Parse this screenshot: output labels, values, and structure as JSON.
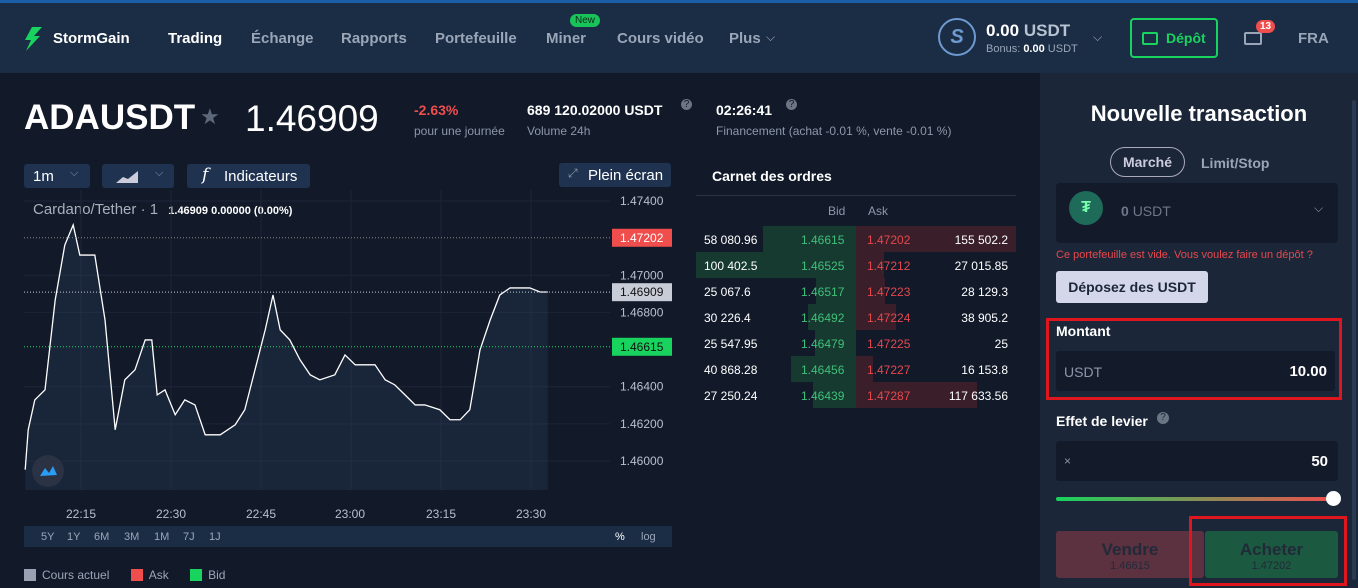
{
  "header": {
    "brand": "StormGain",
    "nav": [
      "Trading",
      "Échange",
      "Rapports",
      "Portefeuille",
      "Miner",
      "Cours vidéo",
      "Plus"
    ],
    "new_badge": "New",
    "balance_amount": "0.00",
    "balance_currency": "USDT",
    "bonus_label": "Bonus:",
    "bonus_amount": "0.00",
    "bonus_currency": "USDT",
    "deposit": "Dépôt",
    "mail_count": "13",
    "lang": "FRA"
  },
  "ticker": {
    "symbol": "ADAUSDT",
    "price": "1.46909",
    "change": "-2.63%",
    "change_label": "pour une journée",
    "volume": "689 120.02000 USDT",
    "volume_label": "Volume 24h",
    "funding_time": "02:26:41",
    "funding_label": "Financement (achat -0.01 %, vente -0.01 %)"
  },
  "toolbar": {
    "interval": "1m",
    "indicators": "Indicateurs",
    "fullscreen": "Plein écran"
  },
  "chart_legend": {
    "pair": "Cardano/Tether",
    "interval": "1",
    "values": "1.46909  0.00000 (0.00%)"
  },
  "timeframes": [
    "5Y",
    "1Y",
    "6M",
    "3M",
    "1M",
    "7J",
    "1J"
  ],
  "scale_options": [
    "%",
    "log"
  ],
  "legend": [
    "Cours actuel",
    "Ask",
    "Bid"
  ],
  "colors": {
    "current": "#9aa1b2",
    "ask": "#f04d4d",
    "bid": "#18d45e"
  },
  "chart_data": {
    "type": "line",
    "title": "Cardano/Tether · 1",
    "xlabel": "",
    "ylabel": "",
    "yticks": [
      "1.47400",
      "1.47000",
      "1.46800",
      "1.46400",
      "1.46200",
      "1.46000"
    ],
    "ylim": [
      1.4595,
      1.475
    ],
    "xticks": [
      "22:15",
      "22:30",
      "22:45",
      "23:00",
      "23:15",
      "23:30"
    ],
    "x_minutes_from_2215": [
      -9.3,
      -8.8,
      -7.7,
      -6,
      -4.3,
      -2.7,
      -1.3,
      -0.2,
      2.3,
      4,
      5.7,
      7.3,
      9,
      10.7,
      11.8,
      12.7,
      14,
      15.7,
      17.3,
      19,
      20.7,
      23.2,
      25.7,
      27.3,
      29,
      30.7,
      32,
      33.2,
      34.8,
      36.5,
      38.2,
      39.8,
      42.3,
      44,
      45.7,
      47.3,
      49,
      50.7,
      52.3,
      54,
      55.7,
      57.3,
      59.8,
      61.5,
      63.2,
      64.8,
      66.5,
      68.2,
      69.8,
      71.5,
      74.8,
      76.5,
      77.8
    ],
    "y": [
      1.45953,
      1.46168,
      1.46329,
      1.46383,
      1.46867,
      1.47163,
      1.47271,
      1.47109,
      1.47109,
      1.4676,
      1.46168,
      1.46437,
      1.46491,
      1.46652,
      1.46652,
      1.46356,
      1.46383,
      1.46249,
      1.46329,
      1.46302,
      1.46141,
      1.46141,
      1.46195,
      1.46276,
      1.46491,
      1.46706,
      1.46894,
      1.46706,
      1.46652,
      1.46545,
      1.46464,
      1.46437,
      1.46464,
      1.46571,
      1.46518,
      1.46518,
      1.46518,
      1.46437,
      1.4641,
      1.46356,
      1.46302,
      1.46302,
      1.46276,
      1.46222,
      1.46222,
      1.46276,
      1.46598,
      1.4676,
      1.46894,
      1.46932,
      1.46932,
      1.4691,
      1.4691
    ],
    "markers": [
      {
        "label": "1.47202",
        "type": "ask"
      },
      {
        "label": "1.46909",
        "type": "current"
      },
      {
        "label": "1.46615",
        "type": "bid"
      }
    ]
  },
  "orderbook": {
    "title": "Carnet des ordres",
    "bid_header": "Bid",
    "ask_header": "Ask",
    "rows": [
      [
        "58 080.96",
        "1.46615",
        "1.47202",
        "155 502.2"
      ],
      [
        "100 402.5",
        "1.46525",
        "1.47212",
        "27 015.85"
      ],
      [
        "25 067.6",
        "1.46517",
        "1.47223",
        "28 129.3"
      ],
      [
        "30 226.4",
        "1.46492",
        "1.47224",
        "38 905.2"
      ],
      [
        "25 547.95",
        "1.46479",
        "1.47225",
        "25"
      ],
      [
        "40 868.28",
        "1.46456",
        "1.47227",
        "16 153.8"
      ],
      [
        "27 250.24",
        "1.46439",
        "1.47287",
        "117 633.56"
      ]
    ]
  },
  "panel": {
    "title": "Nouvelle transaction",
    "tab_market": "Marché",
    "tab_limit": "Limit/Stop",
    "wallet_amount": "0",
    "wallet_currency": "USDT",
    "empty_msg": "Ce portefeuille est vide. Vous voulez faire un dépôt ?",
    "deposit_usdt": "Déposez des USDT",
    "amount_label": "Montant",
    "amount_currency": "USDT",
    "amount_value": "10.00",
    "leverage_label": "Effet de levier",
    "leverage_prefix": "×",
    "leverage_value": "50",
    "leverage_fraction": 1.0,
    "sell": "Vendre",
    "sell_price": "1.46615",
    "buy": "Acheter",
    "buy_price": "1.47202"
  }
}
